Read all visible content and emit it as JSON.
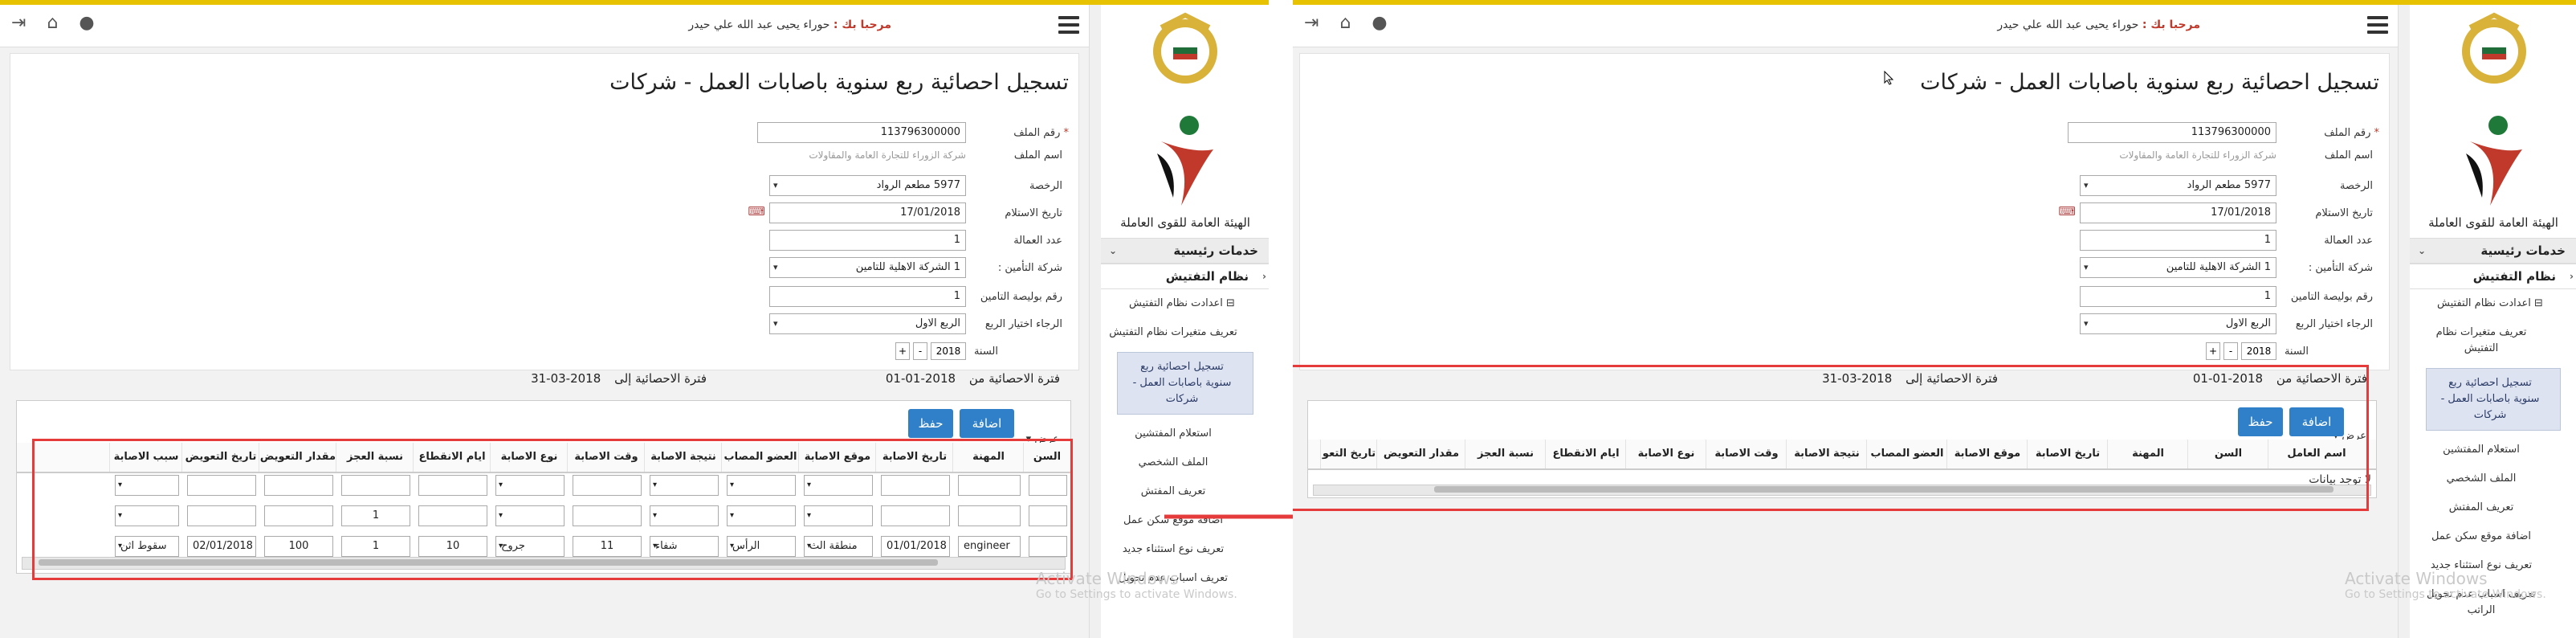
{
  "header": {
    "hello": "مرحبا بك :",
    "user_name": "حوراء يحيى عبد الله علي حيدر"
  },
  "sidebar": {
    "org_name": "الهيئة العامة للقوى العاملة",
    "section_main": "خدمات رئيسية",
    "section_inspection": "نظام التفتيش",
    "group_settings": "اعدادت نظام التفتيش",
    "items_left": [
      "تعريف متغيرات نظام التفتيش",
      "تسجيل احصائية ربع سنوية باصابات العمل - شركات",
      "استعلام المفتشين",
      "الملف الشخصي",
      "تعريف المفتش",
      "اضافة موقع سكن عمل",
      "تعريف نوع استثناء جديد",
      "تعريف اسباب عدم تحويل"
    ],
    "items_right": [
      "تعريف متغيرات نظام التفتيش",
      "تسجيل احصائية ربع سنوية باصابات العمل - شركات",
      "استعلام المفتشين",
      "الملف الشخصي",
      "تعريف المفتش",
      "اضافة موقع سكن عمل",
      "تعريف نوع استثناء جديد",
      "تعريف اسباب عدم تحويل الراتب"
    ]
  },
  "page": {
    "title": "تسجيل احصائية ربع سنوية باصابات العمل - شركات"
  },
  "form": {
    "file_no_label": "رقم الملف",
    "file_no_value": "113796300000",
    "file_name_label": "اسم الملف",
    "file_name_value": "شركة الزوراء للتجارة العامة والمقاولات",
    "license_label": "الرخصة",
    "license_value": "5977 مطعم الرواد",
    "receipt_date_label": "تاريخ الاستلام",
    "receipt_date_value": "17/01/2018",
    "workers_label": "عدد العمالة",
    "workers_value": "1",
    "insurer_label": "شركة التأمين :",
    "insurer_value": "1 الشركة الاهلية للتامين",
    "policy_label": "رقم بوليصة التامين",
    "policy_value": "1",
    "quarter_label": "الرجاء اختيار الربع",
    "quarter_value": "الربع الاول",
    "year_label": "السنة",
    "year_value": "2018",
    "plus": "+",
    "minus": "-"
  },
  "period": {
    "from_label": "فترة الاحصائية من",
    "from_value": "2018-01-01",
    "to_label": "فترة الاحصائية إلى",
    "to_value": "2018-03-31"
  },
  "actions": {
    "add": "اضافة",
    "save": "حفظ",
    "show": "عرض"
  },
  "table_left": {
    "headers": [
      "السن",
      "المهنة",
      "تاريخ الاصابة",
      "موقع الاصابة",
      "العضو المصاب",
      "نتيجة الاصابة",
      "وقت الاصابة",
      "نوع الاصابة",
      "ايام الانقطاع",
      "نسبة العجز",
      "مقدار التعويض",
      "تاريخ التعويض",
      "سبب الاصابة"
    ],
    "rows": [
      [
        "",
        "",
        "",
        "",
        "",
        "",
        "",
        "",
        "",
        "",
        "",
        "",
        ""
      ],
      [
        "",
        "",
        "",
        "",
        "",
        "",
        "",
        "",
        "",
        "1",
        "",
        "",
        ""
      ],
      [
        "",
        "engineer",
        "01/01/2018",
        "منطقة الث",
        "الرأس",
        "شفاء",
        "11",
        "جروح",
        "10",
        "1",
        "100",
        "02/01/2018",
        "سقوط اثن"
      ]
    ]
  },
  "table_right": {
    "headers": [
      "اسم العامل",
      "السن",
      "المهنة",
      "تاريخ الاصابة",
      "موقع الاصابة",
      "العضو المصاب",
      "نتيجة الاصابة",
      "وقت الاصابة",
      "نوع الاصابة",
      "ايام الانقطاع",
      "نسبة العجز",
      "مقدار التعويض",
      "تاريخ التعو"
    ],
    "empty_text": "لا توجد بيانات"
  },
  "watermark": {
    "line1": "Activate Windows",
    "line2": "Go to Settings to activate Windows."
  },
  "colors": {
    "accent": "#2f80c8",
    "top_stripe": "#e6c200",
    "annotation": "#e63b3b",
    "required": "#c0392b"
  }
}
